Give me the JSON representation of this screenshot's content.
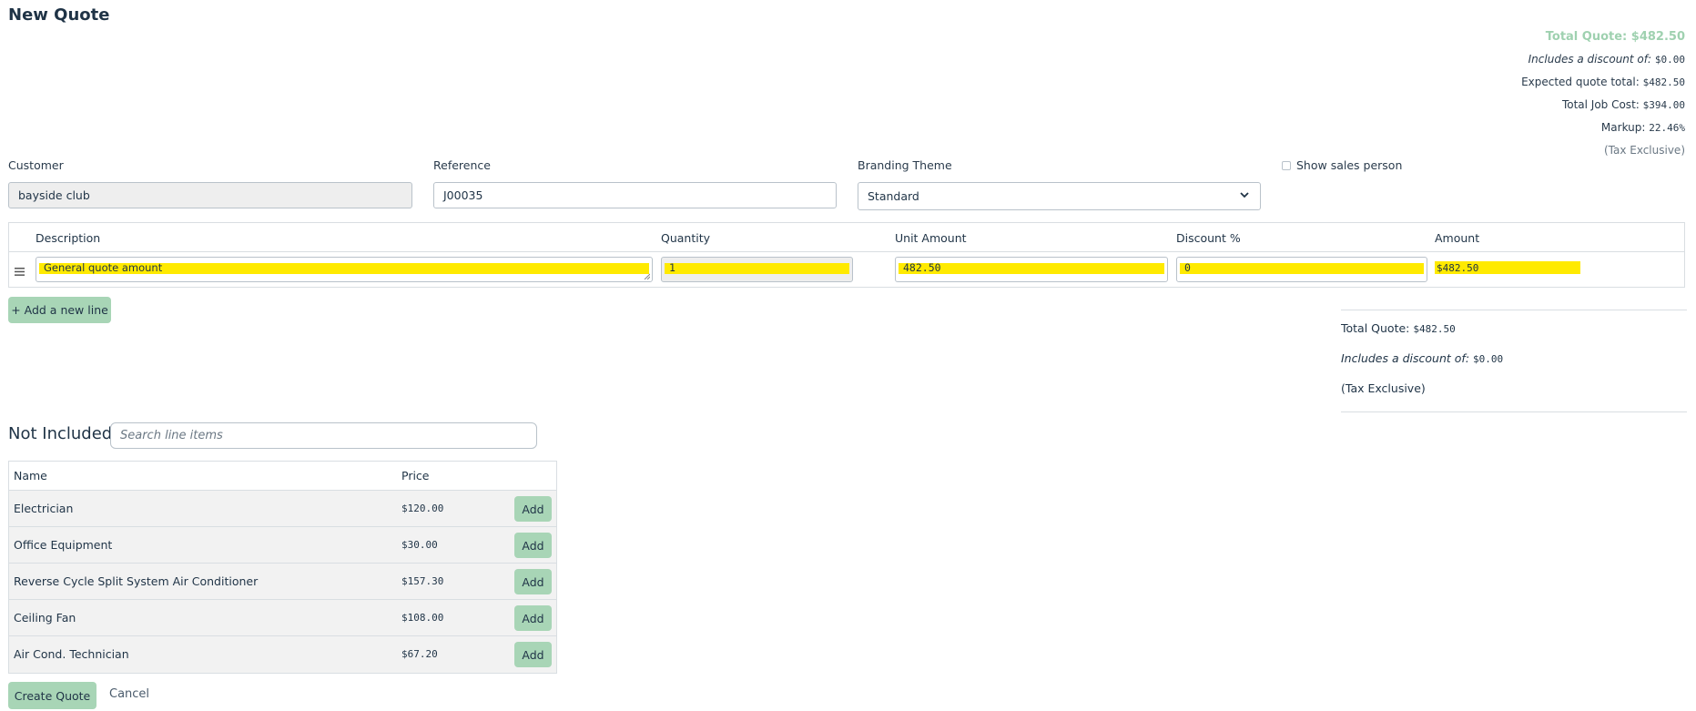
{
  "page": {
    "title": "New Quote"
  },
  "summary_top": {
    "total_quote": "Total Quote: $482.50",
    "discount_label": "Includes a discount of:",
    "discount_value": "$0.00",
    "expected_label": "Expected quote total:",
    "expected_value": "$482.50",
    "job_cost_label": "Total Job Cost:",
    "job_cost_value": "$394.00",
    "markup_label": "Markup:",
    "markup_value": "22.46%",
    "tax_note": "(Tax Exclusive)"
  },
  "form": {
    "customer_label": "Customer",
    "customer_value": "bayside club",
    "reference_label": "Reference",
    "reference_value": "J00035",
    "branding_label": "Branding Theme",
    "branding_value": "Standard",
    "show_sales_label": "Show sales person"
  },
  "lines": {
    "headers": {
      "description": "Description",
      "quantity": "Quantity",
      "unit_amount": "Unit Amount",
      "discount": "Discount %",
      "amount": "Amount"
    },
    "row": {
      "description": "General quote amount",
      "quantity": "1",
      "unit_amount": "482.50",
      "discount": "0",
      "amount": "$482.50"
    },
    "add_line_label": "+ Add a new line"
  },
  "summary_bottom": {
    "total_label": "Total Quote:",
    "total_value": "$482.50",
    "discount_label": "Includes a discount of:",
    "discount_value": "$0.00",
    "tax_note": "(Tax Exclusive)"
  },
  "not_included": {
    "title": "Not Included",
    "search_placeholder": "Search line items",
    "headers": {
      "name": "Name",
      "price": "Price"
    },
    "add_label": "Add",
    "items": [
      {
        "name": "Electrician",
        "price": "$120.00"
      },
      {
        "name": "Office Equipment",
        "price": "$30.00"
      },
      {
        "name": "Reverse Cycle Split System Air Conditioner",
        "price": "$157.30"
      },
      {
        "name": "Ceiling Fan",
        "price": "$108.00"
      },
      {
        "name": "Air Cond. Technician",
        "price": "$67.20"
      }
    ]
  },
  "actions": {
    "create_label": "Create Quote",
    "cancel_label": "Cancel"
  },
  "colors": {
    "accent_green": "#a8d5b6",
    "highlight": "#ffea00",
    "total_green": "#9fd1b0"
  },
  "icons": {
    "drag_handle": "hamburger-drag-icon",
    "chevron": "chevron-down-icon"
  }
}
